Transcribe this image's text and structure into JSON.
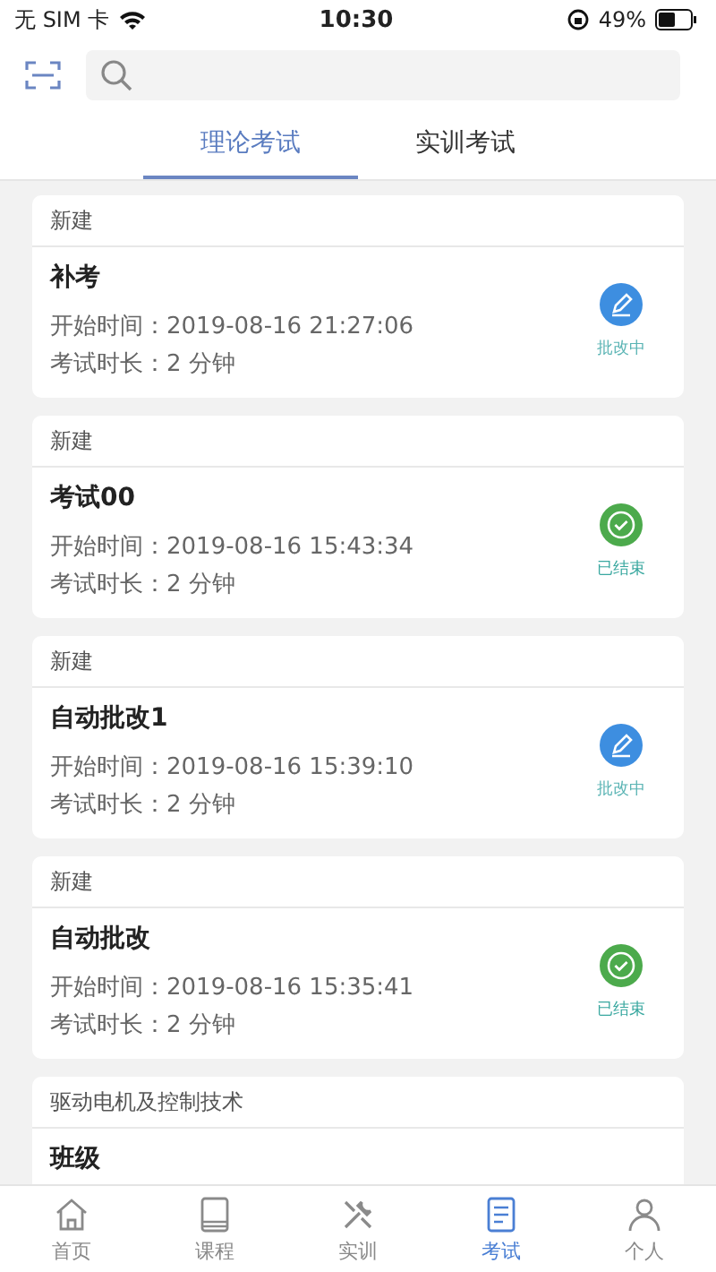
{
  "status_bar": {
    "carrier": "无 SIM 卡",
    "time": "10:30",
    "battery": "49%"
  },
  "tabs": [
    {
      "label": "理论考试",
      "selected": true
    },
    {
      "label": "实训考试",
      "selected": false
    }
  ],
  "exams": [
    {
      "group": "新建",
      "title": "补考",
      "start": "开始时间：2019-08-16 21:27:06",
      "duration": "考试时长：2 分钟",
      "status": {
        "kind": "grading",
        "label": "批改中"
      }
    },
    {
      "group": "新建",
      "title": "考试00",
      "start": "开始时间：2019-08-16 15:43:34",
      "duration": "考试时长：2 分钟",
      "status": {
        "kind": "finished",
        "label": "已结束"
      }
    },
    {
      "group": "新建",
      "title": "自动批改1",
      "start": "开始时间：2019-08-16 15:39:10",
      "duration": "考试时长：2 分钟",
      "status": {
        "kind": "grading",
        "label": "批改中"
      }
    },
    {
      "group": "新建",
      "title": "自动批改",
      "start": "开始时间：2019-08-16 15:35:41",
      "duration": "考试时长：2 分钟",
      "status": {
        "kind": "finished",
        "label": "已结束"
      }
    },
    {
      "group": "驱动电机及控制技术",
      "title": "班级"
    }
  ],
  "bottom_nav": [
    {
      "label": "首页",
      "kind": "home",
      "selected": false
    },
    {
      "label": "课程",
      "kind": "book",
      "selected": false
    },
    {
      "label": "实训",
      "kind": "tools",
      "selected": false
    },
    {
      "label": "考试",
      "kind": "exam",
      "selected": true
    },
    {
      "label": "个人",
      "kind": "person",
      "selected": false
    }
  ]
}
